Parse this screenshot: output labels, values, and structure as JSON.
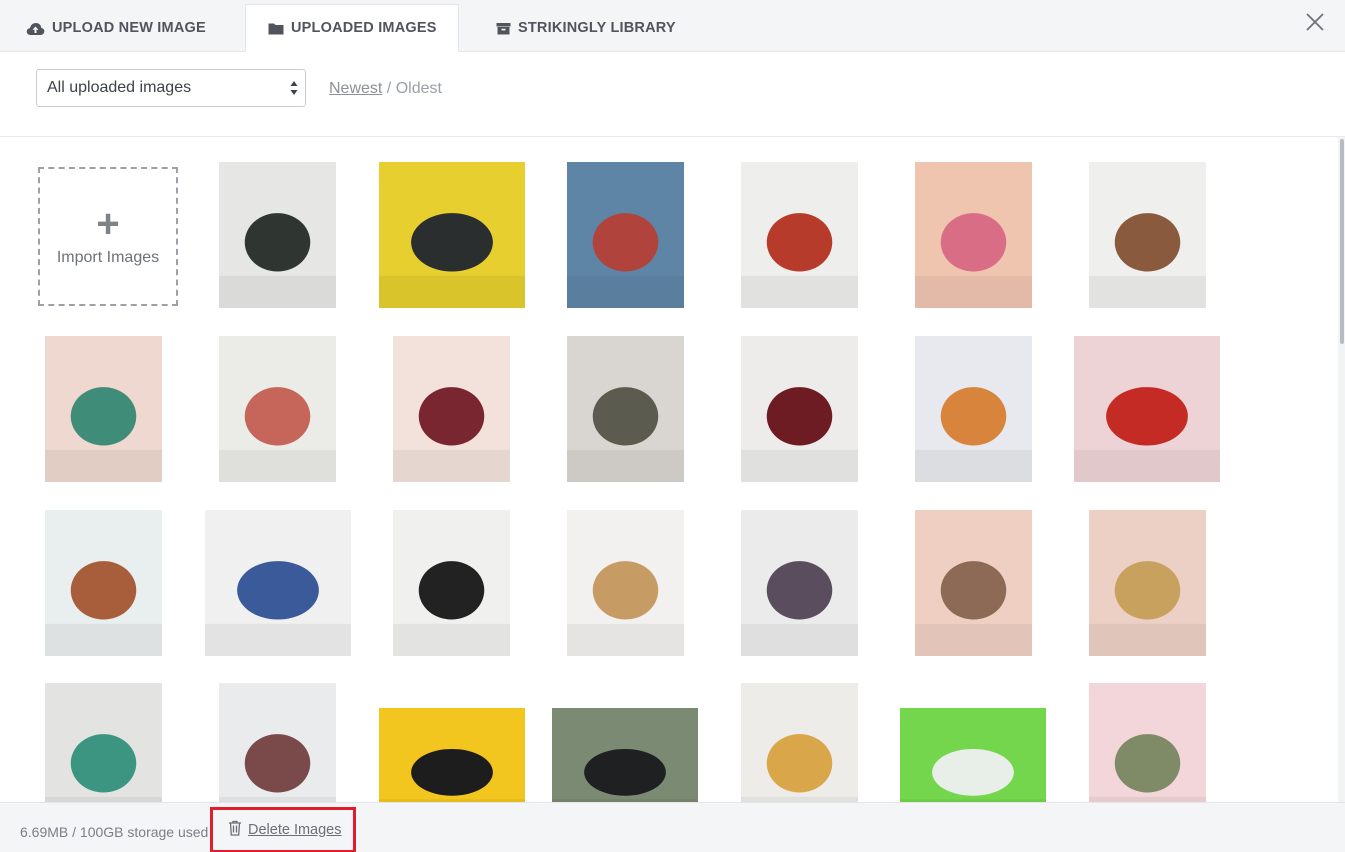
{
  "tabs": [
    {
      "label": "UPLOAD NEW IMAGE",
      "icon": "cloud-upload-icon"
    },
    {
      "label": "UPLOADED IMAGES",
      "icon": "folder-icon",
      "active": true
    },
    {
      "label": "STRIKINGLY LIBRARY",
      "icon": "archive-box-icon"
    }
  ],
  "filter": {
    "selected": "All uploaded images",
    "sort_newest": "Newest",
    "sort_separator": " / ",
    "sort_oldest": "Oldest"
  },
  "import": {
    "plus": "+",
    "label": "Import Images"
  },
  "images": [
    {
      "desc": "shoe-on-block",
      "bg": "#e6e6e4",
      "fg": "#2f3531"
    },
    {
      "desc": "bag-on-yellow",
      "bg": "#e6cf2e",
      "fg": "#2a2e2f"
    },
    {
      "desc": "clutch-blue",
      "bg": "#5f85a6",
      "fg": "#b1433d"
    },
    {
      "desc": "woman-blue-bag",
      "bg": "#eeeeec",
      "fg": "#b73b2a"
    },
    {
      "desc": "gift-box",
      "bg": "#efc5b0",
      "fg": "#d96d86"
    },
    {
      "desc": "ice-cream",
      "bg": "#efefed",
      "fg": "#8a5a3e"
    },
    {
      "desc": "teal-shoe",
      "bg": "#efd8cf",
      "fg": "#3f8c78"
    },
    {
      "desc": "sneaker-box",
      "bg": "#ebebe8",
      "fg": "#c6665a"
    },
    {
      "desc": "red-sandal",
      "bg": "#f3e2dc",
      "fg": "#7a2630"
    },
    {
      "desc": "backpack",
      "bg": "#d9d5d1",
      "fg": "#5b5b4f"
    },
    {
      "desc": "red-handbag",
      "bg": "#edeceb",
      "fg": "#6d1c24"
    },
    {
      "desc": "cake-slices",
      "bg": "#e7e9ee",
      "fg": "#d9843c"
    },
    {
      "desc": "coffee-cup",
      "bg": "#eed3d6",
      "fg": "#c42b25"
    },
    {
      "desc": "burger",
      "bg": "#e9eeee",
      "fg": "#a85d3b"
    },
    {
      "desc": "crown",
      "bg": "#f0f0f0",
      "fg": "#3a5a9a"
    },
    {
      "desc": "boots",
      "bg": "#f0f0ee",
      "fg": "#222222"
    },
    {
      "desc": "cosmetics",
      "bg": "#f2f1ef",
      "fg": "#c79b64"
    },
    {
      "desc": "flower",
      "bg": "#ebebec",
      "fg": "#5a4d5e"
    },
    {
      "desc": "cream-bottles",
      "bg": "#f0cfc3",
      "fg": "#8c6a55"
    },
    {
      "desc": "fork-jewel",
      "bg": "#ecd0c6",
      "fg": "#c9a15e"
    },
    {
      "desc": "teal-shoe-2",
      "bg": "#e3e4e2",
      "fg": "#3b9581"
    },
    {
      "desc": "figs",
      "bg": "#eaebed",
      "fg": "#7a4a4a"
    },
    {
      "desc": "headphones",
      "bg": "#f2c61f",
      "fg": "#1d1d1d"
    },
    {
      "desc": "camera",
      "bg": "#7b8a72",
      "fg": "#1f2022"
    },
    {
      "desc": "potatoes-plate",
      "bg": "#eeece8",
      "fg": "#d9a649"
    },
    {
      "desc": "sneaker-green",
      "bg": "#74d64c",
      "fg": "#e8efe8"
    },
    {
      "desc": "flowers-pink",
      "bg": "#f3d6d9",
      "fg": "#7f8a66"
    }
  ],
  "footer": {
    "storage": "6.69MB / 100GB storage used",
    "delete_label": "Delete Images",
    "delete_icon": "trash-icon",
    "highlight_color": "#e11d2d"
  },
  "close_icon": "close-icon"
}
